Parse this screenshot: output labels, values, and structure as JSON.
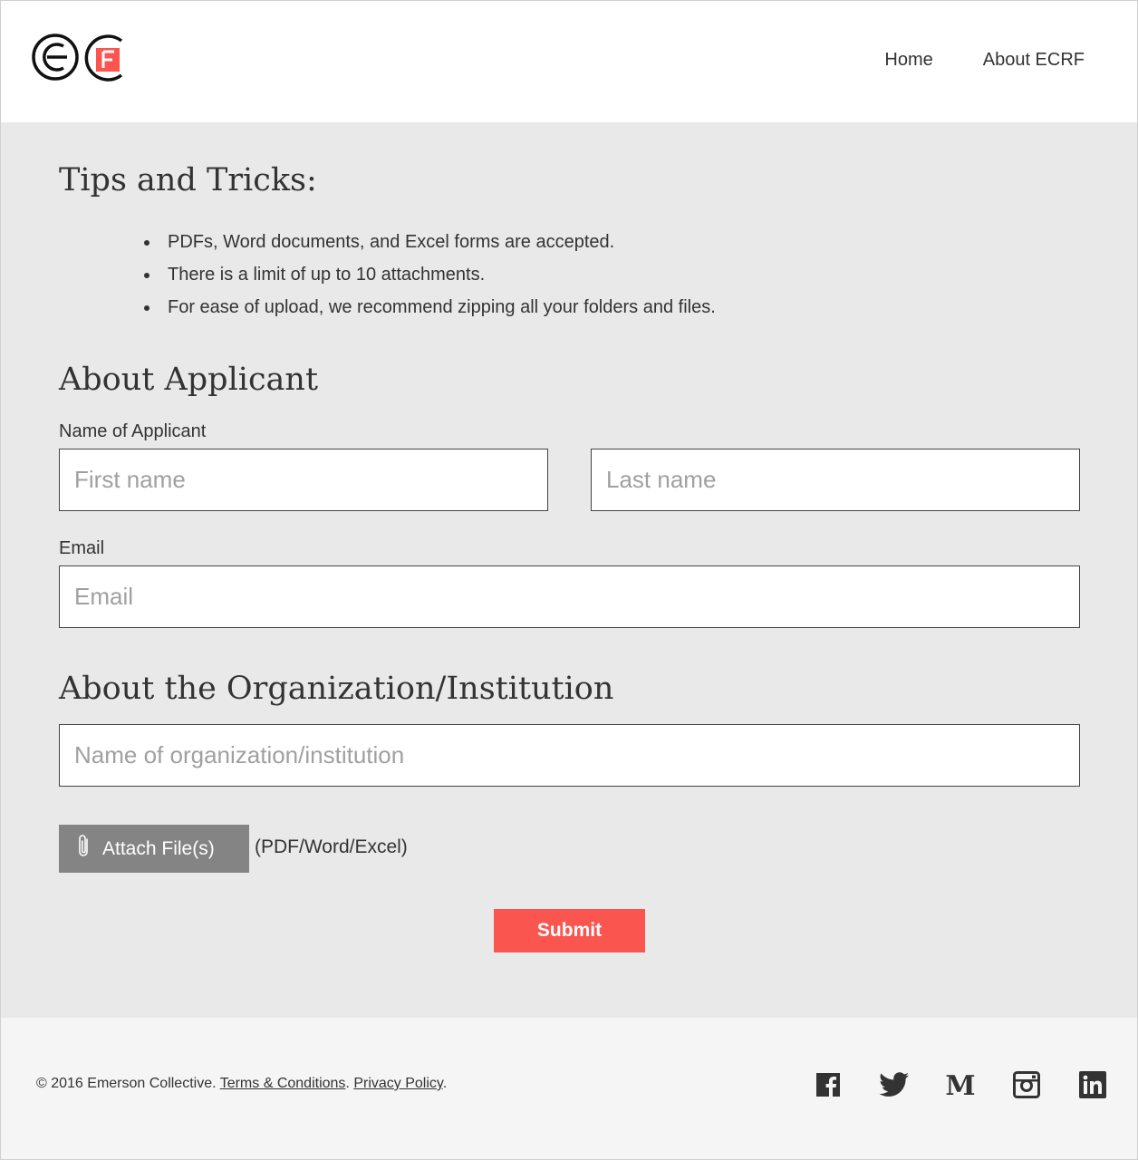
{
  "header": {
    "logo_text": "ECRF",
    "nav": [
      {
        "label": "Home"
      },
      {
        "label": "About ECRF"
      }
    ]
  },
  "tips": {
    "title": "Tips and Tricks:",
    "items": [
      "PDFs, Word documents, and Excel forms are accepted.",
      "There is a limit of up to 10 attachments.",
      "For ease of upload, we recommend zipping all your folders and files."
    ]
  },
  "applicant": {
    "title": "About Applicant",
    "name_label": "Name of Applicant",
    "first_placeholder": "First name",
    "last_placeholder": "Last name",
    "email_label": "Email",
    "email_placeholder": "Email"
  },
  "organization": {
    "title": "About the Organization/Institution",
    "name_placeholder": "Name of organization/institution"
  },
  "attach": {
    "button_label": "Attach File(s)",
    "note": "(PDF/Word/Excel)"
  },
  "submit_label": "Submit",
  "footer": {
    "copyright": "© 2016 Emerson Collective.",
    "terms": "Terms & Conditions",
    "privacy": "Privacy Policy",
    "social": [
      "facebook-icon",
      "twitter-icon",
      "medium-icon",
      "instagram-icon",
      "linkedin-icon"
    ]
  },
  "colors": {
    "accent": "#fb5550",
    "attach_button": "#848484",
    "main_bg": "#e9e9e9",
    "footer_bg": "#f5f5f5"
  }
}
